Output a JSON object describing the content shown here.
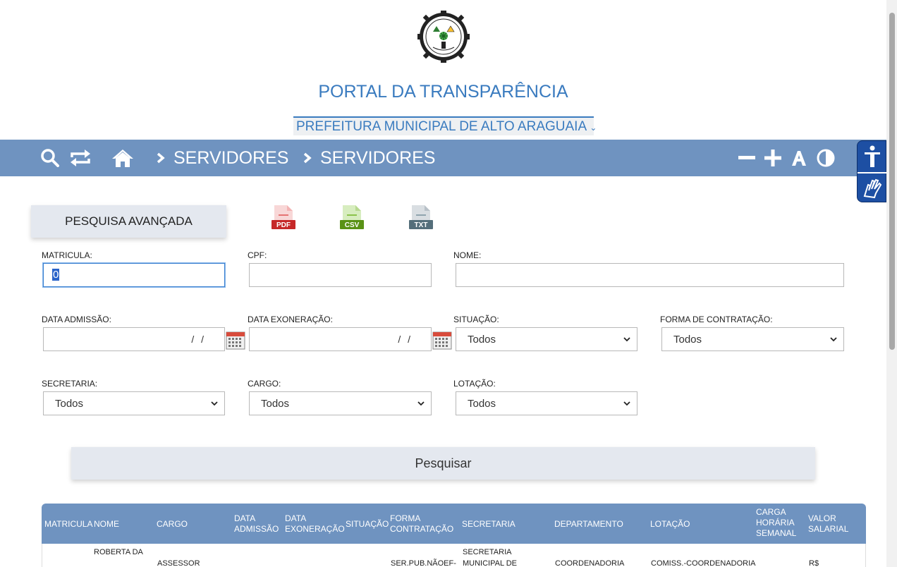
{
  "header": {
    "title": "PORTAL DA TRANSPARÊNCIA",
    "entity_select": "PREFEITURA MUNICIPAL DE ALTO ARAGUAIA"
  },
  "navbar": {
    "breadcrumb": [
      "SERVIDORES",
      "SERVIDORES"
    ]
  },
  "toolbar": {
    "advanced_search": "PESQUISA AVANÇADA",
    "exports": [
      "PDF",
      "CSV",
      "TXT"
    ]
  },
  "form": {
    "matricula": {
      "label": "MATRICULA:",
      "value": "0"
    },
    "cpf": {
      "label": "CPF:",
      "value": ""
    },
    "nome": {
      "label": "NOME:",
      "value": ""
    },
    "data_admissao": {
      "label": "DATA ADMISSÃO:",
      "mask": "/ /"
    },
    "data_exoneracao": {
      "label": "DATA EXONERAÇÃO:",
      "mask": "/ /"
    },
    "situacao": {
      "label": "SITUAÇÃO:",
      "value": "Todos"
    },
    "forma_contratacao": {
      "label": "FORMA DE CONTRATAÇÃO:",
      "value": "Todos"
    },
    "secretaria": {
      "label": "SECRETARIA:",
      "value": "Todos"
    },
    "cargo": {
      "label": "CARGO:",
      "value": "Todos"
    },
    "lotacao": {
      "label": "LOTAÇÃO:",
      "value": "Todos"
    },
    "submit": "Pesquisar"
  },
  "table": {
    "headers": {
      "matricula": "MATRICULA",
      "nome": "NOME",
      "cargo": "CARGO",
      "data_admissao": [
        "DATA",
        "ADMISSÃO"
      ],
      "data_exoneracao": [
        "DATA",
        "EXONERAÇÃO"
      ],
      "situacao": "SITUAÇÃO",
      "forma_contratacao": [
        "FORMA",
        "CONTRATAÇÃO"
      ],
      "secretaria": "SECRETARIA",
      "departamento": "DEPARTAMENTO",
      "lotacao": "LOTAÇÃO",
      "carga_horaria": [
        "CARGA",
        "HORÁRIA",
        "SEMANAL"
      ],
      "valor_salarial": [
        "VALOR",
        "SALARIAL"
      ]
    },
    "rows": [
      {
        "nome": "ROBERTA DA",
        "cargo": "ASSESSOR",
        "forma_contratacao": "SER.PUB.NÃOEF-",
        "secretaria": [
          "SECRETARIA",
          "MUNICIPAL DE"
        ],
        "departamento": "COORDENADORIA",
        "lotacao": "COMISS.-COORDENADORIA",
        "valor_salarial": "R$"
      }
    ]
  },
  "colors": {
    "accent": "#3a7bbf",
    "navbar": "#6f93c0",
    "accessibility": "#1d4fa3",
    "pdf": "#c62828",
    "csv": "#5a9216",
    "txt": "#546e7a"
  },
  "icons": [
    "search-icon",
    "refresh-icon",
    "home-icon",
    "chevron-right-icon",
    "zoom-out-icon",
    "zoom-in-icon",
    "font-icon",
    "contrast-icon",
    "accessibility-icon",
    "sign-language-icon",
    "calendar-icon"
  ]
}
